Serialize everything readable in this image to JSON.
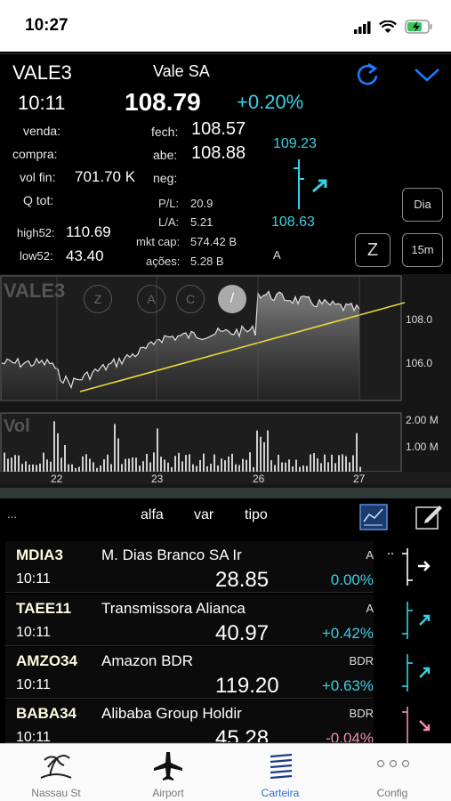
{
  "status_bar": {
    "time": "10:27"
  },
  "quote": {
    "symbol": "VALE3",
    "company": "Vale SA",
    "time": "10:11",
    "price": "108.79",
    "change": "+0.20%",
    "labels": {
      "venda": "venda:",
      "compra": "compra:",
      "vol_fin": "vol fin:",
      "q_tot": "Q tot:",
      "fech": "fech:",
      "abe": "abe:",
      "neg": "neg:",
      "high52": "high52:",
      "low52": "low52:",
      "pl": "P/L:",
      "la": "L/A:",
      "mkt_cap": "mkt cap:",
      "acoes": "ações:"
    },
    "vol_fin": "701.70 K",
    "fech": "108.57",
    "abe": "108.88",
    "high52": "110.69",
    "low52": "43.40",
    "pl": "20.9",
    "la": "5.21",
    "mkt_cap": "574.42 B",
    "acoes": "5.28 B",
    "range_high": "109.23",
    "range_low": "108.63",
    "type": "A",
    "btn_dia": "Dia",
    "btn_z": "Z",
    "btn_15m": "15m",
    "accent": "#3ad0e6",
    "blue": "#1a7cff"
  },
  "chart_data": {
    "type": "line",
    "title": "VALE3",
    "volume_title": "Vol",
    "x_ticks": [
      "22",
      "23",
      "26",
      "27"
    ],
    "y_ticks": [
      "108.0",
      "106.0"
    ],
    "vol_ticks": [
      "2.00 M",
      "1.00 M"
    ],
    "tools": [
      "Z",
      "A",
      "C",
      "/"
    ]
  },
  "list": {
    "header": {
      "dots": "...",
      "alfa": "alfa",
      "var": "var",
      "tipo": "tipo"
    },
    "rows": [
      {
        "sym": "MDIA3",
        "name": "M. Dias Branco SA Ir",
        "type": "A",
        "time": "10:11",
        "price": "28.85",
        "change": "0.00%",
        "color": "#3ad0e6",
        "arrow": "→"
      },
      {
        "sym": "TAEE11",
        "name": "Transmissora Alianca",
        "type": "A",
        "time": "10:11",
        "price": "40.97",
        "change": "+0.42%",
        "color": "#3ad0e6",
        "arrow": "↗"
      },
      {
        "sym": "AMZO34",
        "name": "Amazon BDR",
        "type": "BDR",
        "time": "10:11",
        "price": "119.20",
        "change": "+0.63%",
        "color": "#3ad0e6",
        "arrow": "↗"
      },
      {
        "sym": "BABA34",
        "name": "Alibaba Group Holdir",
        "type": "BDR",
        "time": "10:11",
        "price": "45.28",
        "change": "-0.04%",
        "color": "#f08fb0",
        "arrow": "↘"
      }
    ]
  },
  "tabs": [
    {
      "label": "Nassau St",
      "icon": "island-icon",
      "active": false
    },
    {
      "label": "Airport",
      "icon": "airplane-icon",
      "active": false
    },
    {
      "label": "Carteira",
      "icon": "portfolio-icon",
      "active": true
    },
    {
      "label": "Config",
      "icon": "more-icon",
      "active": false
    }
  ]
}
